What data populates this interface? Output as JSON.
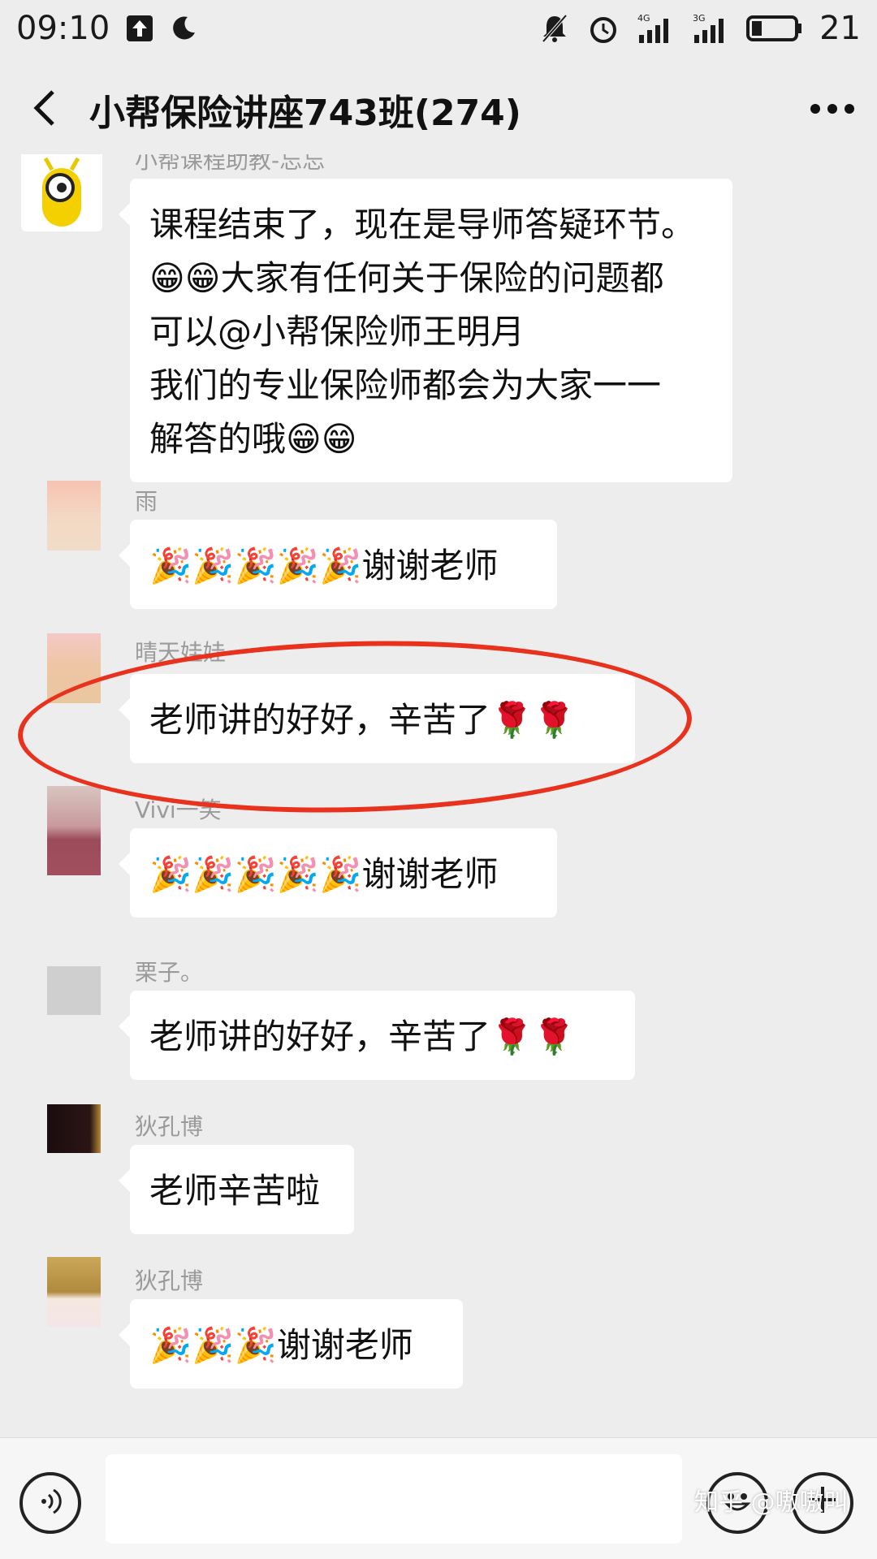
{
  "status_bar": {
    "time": "09:10",
    "network_1": "4G",
    "network_2": "3G",
    "battery": "21"
  },
  "header": {
    "title": "小帮保险讲座743班(274)"
  },
  "messages": [
    {
      "sender": "小帮课程助教-忘忘",
      "lines": [
        "课程结束了，现在是导师答疑环节。",
        "😁😁大家有任何关于保险的问题都",
        "可以@小帮保险师王明月",
        "我们的专业保险师都会为大家一一",
        "解答的哦😁😁"
      ]
    },
    {
      "sender": "雨",
      "lines": [
        "🎉🎉🎉🎉🎉谢谢老师"
      ]
    },
    {
      "sender": "晴天娃娃",
      "lines": [
        "老师讲的好好，辛苦了🌹🌹"
      ]
    },
    {
      "sender": "Vivi一笑",
      "lines": [
        "🎉🎉🎉🎉🎉谢谢老师"
      ]
    },
    {
      "sender": "栗子。",
      "lines": [
        "老师讲的好好，辛苦了🌹🌹"
      ]
    },
    {
      "sender": "狄孔博",
      "lines": [
        "老师辛苦啦"
      ]
    },
    {
      "sender": "狄孔博",
      "lines": [
        "🎉🎉🎉谢谢老师"
      ]
    }
  ],
  "input": {
    "placeholder": ""
  },
  "watermark": "知乎 @嗷嗷叫",
  "colors": {
    "background": "#ededed",
    "bubble": "#ffffff",
    "highlight": "#e8321e",
    "sender_text": "#9a9a9a"
  },
  "icons": {
    "back": "chevron-left-icon",
    "more": "more-dots-icon",
    "voice": "voice-icon",
    "emoji": "emoji-icon",
    "plus": "plus-icon"
  }
}
